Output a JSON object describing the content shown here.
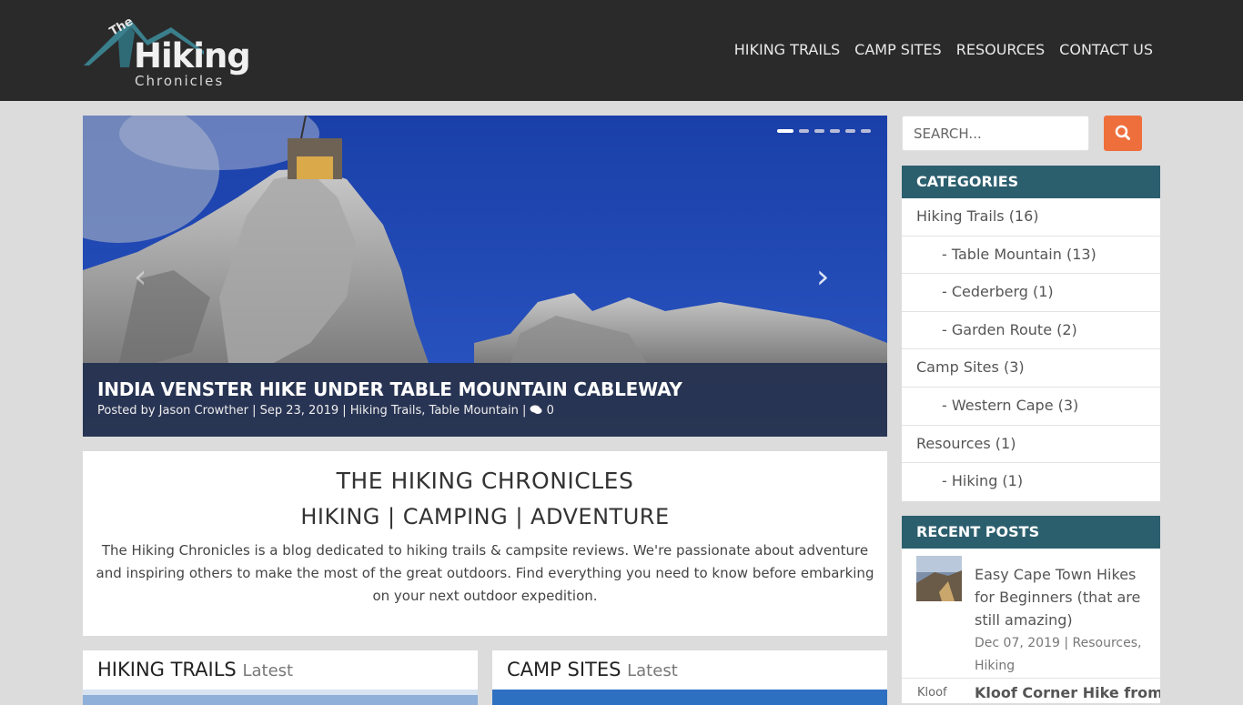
{
  "site": {
    "logo_the": "The",
    "logo_hiking": "Hiking",
    "logo_chronicles": "Chronicles"
  },
  "nav": {
    "items": [
      "HIKING TRAILS",
      "CAMP SITES",
      "RESOURCES",
      "CONTACT US"
    ]
  },
  "slider": {
    "title": "INDIA VENSTER HIKE UNDER TABLE MOUNTAIN CABLEWAY",
    "meta": "Posted by Jason Crowther | Sep 23, 2019 | Hiking Trails, Table Mountain | ",
    "comment_count": "0",
    "dots_total": 6,
    "dots_active": 1,
    "prev_glyph": "‹",
    "next_glyph": "›"
  },
  "intro": {
    "title": "THE HIKING CHRONICLES",
    "subtitle": "HIKING | CAMPING | ADVENTURE",
    "text": "The Hiking Chronicles is a blog dedicated to hiking trails & campsite reviews. We're passionate about adventure and inspiring others to make the most of the great outdoors. Find everything you need to know before embarking on your next outdoor expedition."
  },
  "sections": {
    "hiking_title": "HIKING TRAILS",
    "camp_title": "CAMP SITES",
    "latest": "Latest"
  },
  "sidebar": {
    "search_placeholder": "SEARCH...",
    "categories_title": "CATEGORIES",
    "categories": [
      {
        "label": "Hiking Trails (16)",
        "level": 0
      },
      {
        "label": "- Table Mountain (13)",
        "level": 1
      },
      {
        "label": "- Cederberg (1)",
        "level": 1
      },
      {
        "label": "- Garden Route (2)",
        "level": 1
      },
      {
        "label": "Camp Sites (3)",
        "level": 0
      },
      {
        "label": "- Western Cape (3)",
        "level": 1
      },
      {
        "label": "Resources (1)",
        "level": 0
      },
      {
        "label": "- Hiking (1)",
        "level": 1
      }
    ],
    "recent_title": "RECENT POSTS",
    "recent": [
      {
        "title": "Easy Cape Town Hikes for Beginners (that are still amazing)",
        "meta": "Dec 07, 2019 | Resources, Hiking"
      },
      {
        "image_alt": "Kloof",
        "title": "Kloof Corner Hike from"
      }
    ]
  },
  "colors": {
    "header_bg": "#2b2a2b",
    "widget_head": "#2c5f6e",
    "search_button": "#ee6f3c",
    "page_bg": "#dcdcdd"
  }
}
